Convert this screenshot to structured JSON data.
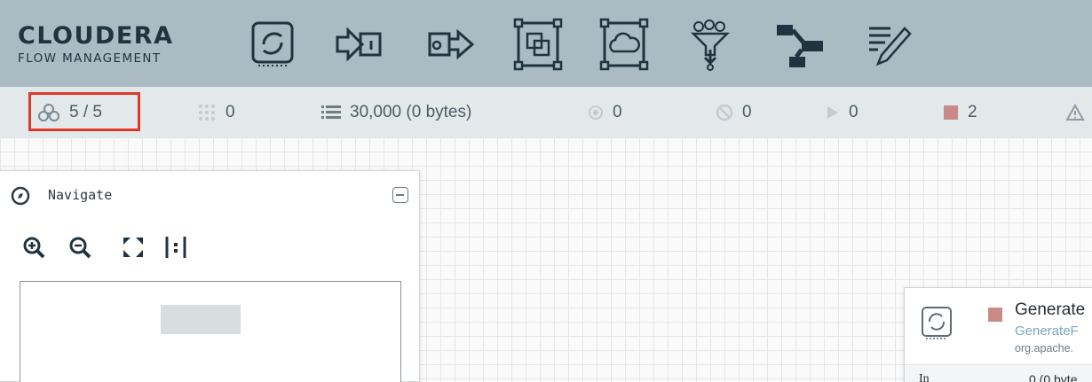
{
  "header": {
    "brand_name": "CLOUDERA",
    "brand_sub": "FLOW MANAGEMENT",
    "toolbar_icons": [
      "processor-icon",
      "input-port-icon",
      "output-port-icon",
      "process-group-icon",
      "remote-process-group-icon",
      "funnel-icon",
      "template-icon",
      "label-icon"
    ]
  },
  "status": {
    "cluster_nodes": "5 / 5",
    "transmitting": "0",
    "queued": "30,000 (0 bytes)",
    "running": "0",
    "invalid": "0",
    "stopped_play": "0",
    "stopped": "2",
    "colors": {
      "highlight": "#e0382b",
      "stopped": "#c98b88"
    }
  },
  "navigate": {
    "title": "Navigate",
    "buttons": [
      "zoom-in-icon",
      "zoom-out-icon",
      "fit-icon",
      "actual-size-icon"
    ]
  },
  "processor": {
    "name": "Generate",
    "type": "GenerateF",
    "bundle": "org.apache.",
    "in_label": "In",
    "in_value": "0 (0 byte"
  }
}
